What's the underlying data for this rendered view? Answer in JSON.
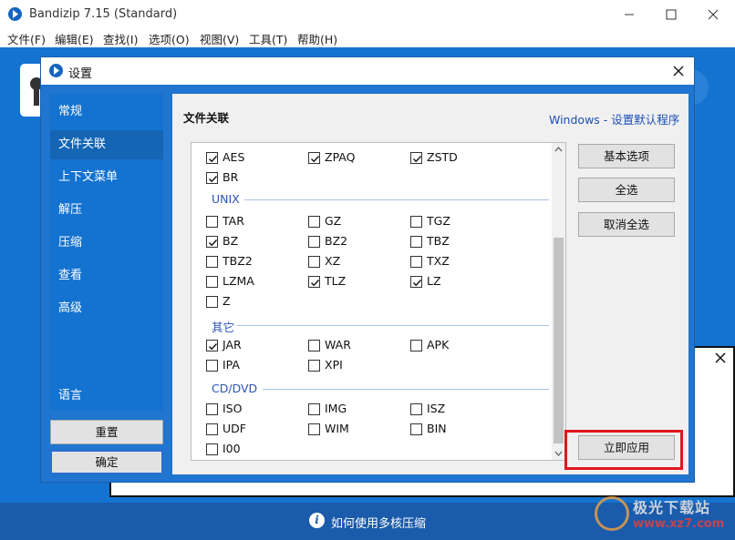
{
  "window": {
    "title": "Bandizip 7.15 (Standard)",
    "menu": [
      "文件(F)",
      "编辑(E)",
      "查找(I)",
      "选项(O)",
      "视图(V)",
      "工具(T)",
      "帮助(H)"
    ]
  },
  "bottom_bar": {
    "text": "如何使用多核压缩"
  },
  "watermark": {
    "line1": "极光下载站",
    "line2": "www.xz7.com"
  },
  "dialog": {
    "title": "设置",
    "nav": [
      "常规",
      "文件关联",
      "上下文菜单",
      "解压",
      "压缩",
      "查看",
      "高级",
      "语言"
    ],
    "active_nav": "文件关联",
    "reset_label": "重置",
    "ok_label": "确定",
    "section_title": "文件关联",
    "windows_link": "Windows - 设置默认程序",
    "side_buttons": {
      "basic": "基本选项",
      "select_all": "全选",
      "deselect_all": "取消全选",
      "apply_now": "立即应用"
    },
    "groups": {
      "unix": "UNIX",
      "other": "其它",
      "cddvd": "CD/DVD"
    },
    "items": [
      {
        "label": "AES",
        "checked": true
      },
      {
        "label": "ZPAQ",
        "checked": true
      },
      {
        "label": "ZSTD",
        "checked": true
      },
      {
        "label": "BR",
        "checked": true
      },
      {
        "label": "TAR",
        "checked": false
      },
      {
        "label": "GZ",
        "checked": false
      },
      {
        "label": "TGZ",
        "checked": false
      },
      {
        "label": "BZ",
        "checked": true
      },
      {
        "label": "BZ2",
        "checked": false
      },
      {
        "label": "TBZ",
        "checked": false
      },
      {
        "label": "TBZ2",
        "checked": false
      },
      {
        "label": "XZ",
        "checked": false
      },
      {
        "label": "TXZ",
        "checked": false
      },
      {
        "label": "LZMA",
        "checked": false
      },
      {
        "label": "TLZ",
        "checked": true
      },
      {
        "label": "LZ",
        "checked": true
      },
      {
        "label": "Z",
        "checked": false
      },
      {
        "label": "JAR",
        "checked": true
      },
      {
        "label": "WAR",
        "checked": false
      },
      {
        "label": "APK",
        "checked": false
      },
      {
        "label": "IPA",
        "checked": false
      },
      {
        "label": "XPI",
        "checked": false
      },
      {
        "label": "ISO",
        "checked": false
      },
      {
        "label": "IMG",
        "checked": false
      },
      {
        "label": "ISZ",
        "checked": false
      },
      {
        "label": "UDF",
        "checked": false
      },
      {
        "label": "WIM",
        "checked": false
      },
      {
        "label": "BIN",
        "checked": false
      },
      {
        "label": "I00",
        "checked": false
      }
    ]
  }
}
